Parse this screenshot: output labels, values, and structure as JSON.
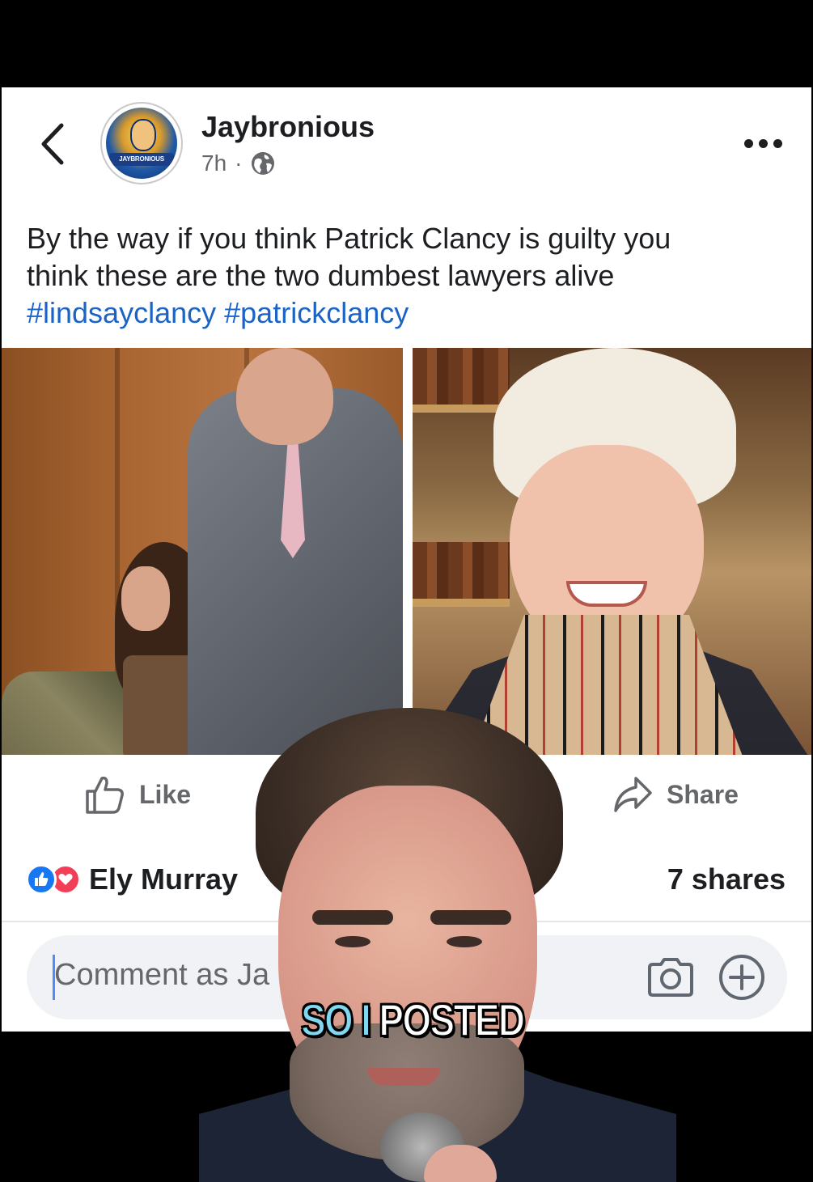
{
  "post": {
    "author": "Jaybronious",
    "time": "7h",
    "separator": "·",
    "avatar_text": "JAYBRONIOUS",
    "text_line1": "By the way if you think Patrick Clancy is guilty you",
    "text_line2": "think these are the two dumbest lawyers alive",
    "hashtags": [
      "#lindsayclancy",
      "#patrickclancy"
    ]
  },
  "actions": {
    "like_label": "Like",
    "share_label": "Share"
  },
  "engagement": {
    "reaction_names": "Ely Murray",
    "shares": "7 shares"
  },
  "comment": {
    "placeholder": "Comment as Ja"
  },
  "video_caption": {
    "part1": "SO I ",
    "part2": "POSTED"
  },
  "icons": [
    "back-chevron-icon",
    "more-options-icon",
    "globe-icon",
    "thumbs-up-icon",
    "share-arrow-icon",
    "like-reaction-icon",
    "love-reaction-icon",
    "camera-icon",
    "plus-circle-icon"
  ],
  "colors": {
    "hashtag": "#1a63c7",
    "like_reaction": "#1877f2",
    "love_reaction": "#f33e58",
    "caption_accent": "#7fd7f0"
  }
}
